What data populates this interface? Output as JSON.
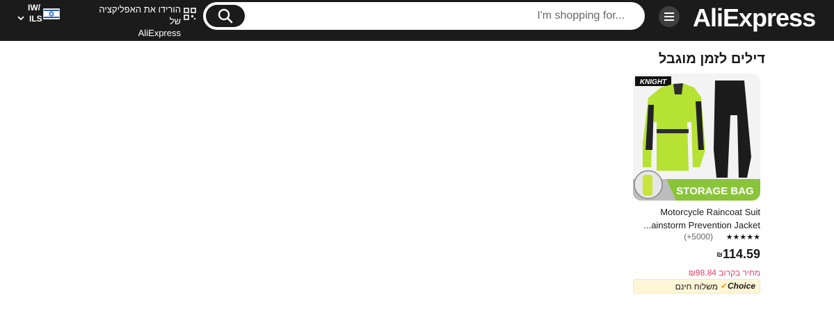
{
  "header": {
    "logo_text": "AliExpress",
    "search": {
      "placeholder": "I'm shopping for..."
    },
    "app_download": {
      "line1": "הורידו את האפליקציה של",
      "line2": "AliExpress"
    },
    "locale": {
      "language": "IW/",
      "currency": "ILS"
    }
  },
  "section": {
    "title": "דילים לזמן מוגבל"
  },
  "product": {
    "image_brand": "KNIGHT",
    "image_caption": "STORAGE BAG",
    "name_line1": "Motorcycle Raincoat Suit",
    "name_line2": "...ainstorm Prevention Jacket",
    "stars": "★★★★★",
    "reviews": "(+5000)",
    "price": "114.59",
    "currency_symbol": "₪",
    "soon_price": "מחיר בקרוב ₪98.84",
    "choice_label": "Choice",
    "free_shipping": "משלוח חינם"
  },
  "colors": {
    "header_bg": "#1b1b1b",
    "accent_pink": "#e8436b",
    "choice_bg": "#fff6d8"
  }
}
